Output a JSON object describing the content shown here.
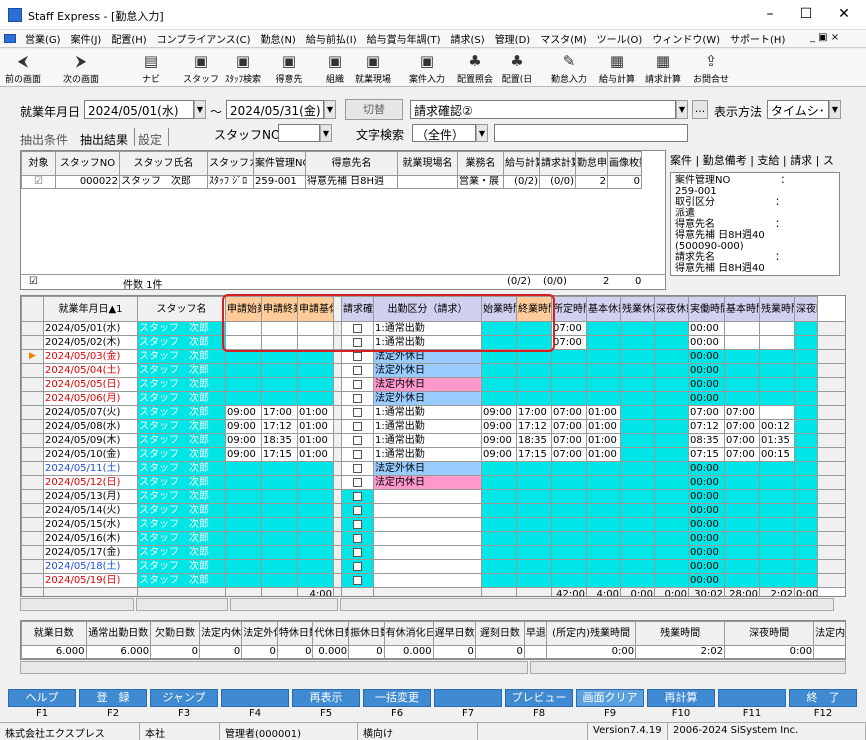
{
  "window": {
    "title": "Staff Express - [勤怠入力]",
    "min": "–",
    "max": "☐",
    "close": "✕"
  },
  "menu": [
    "営業(G)",
    "案件(J)",
    "配置(H)",
    "コンプライアンス(C)",
    "勤怠(N)",
    "給与前払(I)",
    "給与賞与年調(T)",
    "請求(S)",
    "管理(D)",
    "マスタ(M)",
    "ツール(O)",
    "ウィンドウ(W)",
    "サポート(H)"
  ],
  "menu_right": "_ ▣ ×",
  "toolbar": [
    {
      "label": "前の画面",
      "icon": "⮜"
    },
    {
      "label": "次の画面",
      "icon": "⮞"
    },
    {
      "label": "ナビ",
      "icon": "▤"
    },
    {
      "label": "スタッフ",
      "icon": "▣"
    },
    {
      "label": "ｽﾀｯﾌ検索",
      "icon": "▣"
    },
    {
      "label": "得意先",
      "icon": "▣"
    },
    {
      "label": "組織",
      "icon": "▣"
    },
    {
      "label": "就業現場",
      "icon": "▣"
    },
    {
      "label": "案件入力",
      "icon": "▣"
    },
    {
      "label": "配置照会",
      "icon": "♣"
    },
    {
      "label": "配置(日",
      "icon": "♣"
    },
    {
      "label": "勤怠入力",
      "icon": "✎"
    },
    {
      "label": "給与計算",
      "icon": "▦"
    },
    {
      "label": "請求計算",
      "icon": "▦"
    },
    {
      "label": "お問合せ",
      "icon": "⇪"
    }
  ],
  "filter": {
    "label": "就業年月日",
    "from": "2024/05/01(水)",
    "tilde": "～",
    "to": "2024/05/31(金)",
    "switch": "切替",
    "mode": "請求確認②",
    "dots": "...",
    "display_label": "表示方法",
    "display_value": "タイムシ･",
    "tabs": [
      "抽出条件",
      "抽出結果",
      "設定"
    ],
    "staff_label": "スタッフNO",
    "text_search_label": "文字検索",
    "text_search_value": "（全件）"
  },
  "top_table": {
    "headers": [
      "対象",
      "スタッフNO",
      "スタッフ氏名",
      "スタッフカナ",
      "案件管理NO",
      "得意先名",
      "就業現場名",
      "業務名",
      "給与計算",
      "請求計算",
      "勤怠申請",
      "画像枚数"
    ],
    "row": [
      "☑",
      "000022",
      "スタッフ　次郎",
      "ｽﾀｯﾌ ｼﾞﾛ",
      "259-001",
      "得意先補 日8H週",
      "",
      "営業・展",
      "(0/2)",
      "(0/0)",
      "2",
      "0"
    ],
    "footer": {
      "count": "件数 1件",
      "kyuyo": "(0/2)",
      "seikyu": "(0/0)",
      "shinsei": "2",
      "gazou": "0"
    }
  },
  "side_panel": {
    "tabs": [
      "案件",
      "勤怠備考",
      "支給",
      "請求",
      "ス"
    ],
    "lines": [
      "案件管理NO　　　　　：",
      "259-001",
      "取引区分　　　　　　：",
      "派遣",
      "得意先名　　　　　　：",
      "得意先補 日8H週40",
      "(500090-000)",
      "請求先名　　　　　　：",
      "得意先補 日8H週40"
    ]
  },
  "grid": {
    "headers": {
      "date": "就業年月日▲1",
      "staff": "スタッフ名",
      "sin_start": "申請始業",
      "sin_end": "申請終業",
      "sin_break": "申請基休",
      "confirm": "請求確認",
      "kubun": "出勤区分（請求）",
      "start": "始業時間",
      "end": "終業時間",
      "shotei": "所定時間",
      "kihon": "基本休憩",
      "zangyo": "残業休憩",
      "shinya": "深夜休憩",
      "jitsu": "実働時間",
      "kihon2": "基本時間",
      "zangyo2": "残業時間",
      "shinya2": "深夜時間"
    },
    "rows": [
      {
        "date": "2024/05/01(水)",
        "staff": "スタッフ　次郎",
        "ss": "",
        "se": "",
        "sb": "",
        "k": "1:通常出勤",
        "st": "",
        "en": "",
        "sh": "07:00",
        "kh": "",
        "zk": "",
        "sk": "",
        "j": "00:00",
        "k2": "",
        "z2": "",
        "n2": "",
        "dc": "",
        "bg": "w"
      },
      {
        "date": "2024/05/02(木)",
        "staff": "スタッフ　次郎",
        "ss": "",
        "se": "",
        "sb": "",
        "k": "1:通常出勤",
        "st": "",
        "en": "",
        "sh": "07:00",
        "kh": "",
        "zk": "",
        "sk": "",
        "j": "00:00",
        "k2": "",
        "z2": "",
        "n2": "",
        "dc": "",
        "bg": "w"
      },
      {
        "date": "2024/05/03(金)",
        "staff": "スタッフ　次郎",
        "ss": "",
        "se": "",
        "sb": "",
        "k": "法定外休日",
        "st": "",
        "en": "",
        "sh": "",
        "kh": "",
        "zk": "",
        "sk": "",
        "j": "00:00",
        "k2": "",
        "z2": "",
        "n2": "",
        "dc": "red",
        "bg": "b"
      },
      {
        "date": "2024/05/04(土)",
        "staff": "スタッフ　次郎",
        "ss": "",
        "se": "",
        "sb": "",
        "k": "法定外休日",
        "st": "",
        "en": "",
        "sh": "",
        "kh": "",
        "zk": "",
        "sk": "",
        "j": "00:00",
        "k2": "",
        "z2": "",
        "n2": "",
        "dc": "red",
        "bg": "b"
      },
      {
        "date": "2024/05/05(日)",
        "staff": "スタッフ　次郎",
        "ss": "",
        "se": "",
        "sb": "",
        "k": "法定内休日",
        "st": "",
        "en": "",
        "sh": "",
        "kh": "",
        "zk": "",
        "sk": "",
        "j": "00:00",
        "k2": "",
        "z2": "",
        "n2": "",
        "dc": "red",
        "bg": "p"
      },
      {
        "date": "2024/05/06(月)",
        "staff": "スタッフ　次郎",
        "ss": "",
        "se": "",
        "sb": "",
        "k": "法定外休日",
        "st": "",
        "en": "",
        "sh": "",
        "kh": "",
        "zk": "",
        "sk": "",
        "j": "00:00",
        "k2": "",
        "z2": "",
        "n2": "",
        "dc": "red",
        "bg": "b"
      },
      {
        "date": "2024/05/07(火)",
        "staff": "スタッフ　次郎",
        "ss": "09:00",
        "se": "17:00",
        "sb": "01:00",
        "k": "1:通常出勤",
        "st": "09:00",
        "en": "17:00",
        "sh": "07:00",
        "kh": "01:00",
        "zk": "",
        "sk": "",
        "j": "07:00",
        "k2": "07:00",
        "z2": "",
        "n2": "",
        "dc": "",
        "bg": "w"
      },
      {
        "date": "2024/05/08(水)",
        "staff": "スタッフ　次郎",
        "ss": "09:00",
        "se": "17:12",
        "sb": "01:00",
        "k": "1:通常出勤",
        "st": "09:00",
        "en": "17:12",
        "sh": "07:00",
        "kh": "01:00",
        "zk": "",
        "sk": "",
        "j": "07:12",
        "k2": "07:00",
        "z2": "00:12",
        "n2": "",
        "dc": "",
        "bg": "w"
      },
      {
        "date": "2024/05/09(木)",
        "staff": "スタッフ　次郎",
        "ss": "09:00",
        "se": "18:35",
        "sb": "01:00",
        "k": "1:通常出勤",
        "st": "09:00",
        "en": "18:35",
        "sh": "07:00",
        "kh": "01:00",
        "zk": "",
        "sk": "",
        "j": "08:35",
        "k2": "07:00",
        "z2": "01:35",
        "n2": "",
        "dc": "",
        "bg": "w"
      },
      {
        "date": "2024/05/10(金)",
        "staff": "スタッフ　次郎",
        "ss": "09:00",
        "se": "17:15",
        "sb": "01:00",
        "k": "1:通常出勤",
        "st": "09:00",
        "en": "17:15",
        "sh": "07:00",
        "kh": "01:00",
        "zk": "",
        "sk": "",
        "j": "07:15",
        "k2": "07:00",
        "z2": "00:15",
        "n2": "",
        "dc": "",
        "bg": "w"
      },
      {
        "date": "2024/05/11(土)",
        "staff": "スタッフ　次郎",
        "ss": "",
        "se": "",
        "sb": "",
        "k": "法定外休日",
        "st": "",
        "en": "",
        "sh": "",
        "kh": "",
        "zk": "",
        "sk": "",
        "j": "00:00",
        "k2": "",
        "z2": "",
        "n2": "",
        "dc": "blue",
        "bg": "b"
      },
      {
        "date": "2024/05/12(日)",
        "staff": "スタッフ　次郎",
        "ss": "",
        "se": "",
        "sb": "",
        "k": "法定内休日",
        "st": "",
        "en": "",
        "sh": "",
        "kh": "",
        "zk": "",
        "sk": "",
        "j": "00:00",
        "k2": "",
        "z2": "",
        "n2": "",
        "dc": "red",
        "bg": "p"
      },
      {
        "date": "2024/05/13(月)",
        "staff": "スタッフ　次郎",
        "ss": "",
        "se": "",
        "sb": "",
        "k": "",
        "st": "",
        "en": "",
        "sh": "",
        "kh": "",
        "zk": "",
        "sk": "",
        "j": "00:00",
        "k2": "",
        "z2": "",
        "n2": "",
        "dc": "",
        "bg": "c"
      },
      {
        "date": "2024/05/14(火)",
        "staff": "スタッフ　次郎",
        "ss": "",
        "se": "",
        "sb": "",
        "k": "",
        "st": "",
        "en": "",
        "sh": "",
        "kh": "",
        "zk": "",
        "sk": "",
        "j": "00:00",
        "k2": "",
        "z2": "",
        "n2": "",
        "dc": "",
        "bg": "c"
      },
      {
        "date": "2024/05/15(水)",
        "staff": "スタッフ　次郎",
        "ss": "",
        "se": "",
        "sb": "",
        "k": "",
        "st": "",
        "en": "",
        "sh": "",
        "kh": "",
        "zk": "",
        "sk": "",
        "j": "00:00",
        "k2": "",
        "z2": "",
        "n2": "",
        "dc": "",
        "bg": "c"
      },
      {
        "date": "2024/05/16(木)",
        "staff": "スタッフ　次郎",
        "ss": "",
        "se": "",
        "sb": "",
        "k": "",
        "st": "",
        "en": "",
        "sh": "",
        "kh": "",
        "zk": "",
        "sk": "",
        "j": "00:00",
        "k2": "",
        "z2": "",
        "n2": "",
        "dc": "",
        "bg": "c"
      },
      {
        "date": "2024/05/17(金)",
        "staff": "スタッフ　次郎",
        "ss": "",
        "se": "",
        "sb": "",
        "k": "",
        "st": "",
        "en": "",
        "sh": "",
        "kh": "",
        "zk": "",
        "sk": "",
        "j": "00:00",
        "k2": "",
        "z2": "",
        "n2": "",
        "dc": "",
        "bg": "c"
      },
      {
        "date": "2024/05/18(土)",
        "staff": "スタッフ　次郎",
        "ss": "",
        "se": "",
        "sb": "",
        "k": "",
        "st": "",
        "en": "",
        "sh": "",
        "kh": "",
        "zk": "",
        "sk": "",
        "j": "00:00",
        "k2": "",
        "z2": "",
        "n2": "",
        "dc": "blue",
        "bg": "c"
      },
      {
        "date": "2024/05/19(日)",
        "staff": "スタッフ　次郎",
        "ss": "",
        "se": "",
        "sb": "",
        "k": "",
        "st": "",
        "en": "",
        "sh": "",
        "kh": "",
        "zk": "",
        "sk": "",
        "j": "00:00",
        "k2": "",
        "z2": "",
        "n2": "",
        "dc": "red",
        "bg": "c"
      }
    ],
    "totals": {
      "sb": "4:00",
      "sh": "42:00",
      "kh": "4:00",
      "zk": "0:00",
      "sk": "0:00",
      "j": "30:02",
      "k2": "28:00",
      "z2": "2:02",
      "n2": "0:00"
    }
  },
  "summary": {
    "headers": [
      "就業日数",
      "通常出勤日数",
      "欠勤日数",
      "法定内休出日",
      "法定外休",
      "特休日数",
      "代休日数",
      "振休日数",
      "有休消化日数",
      "遅早日数",
      "遅刻日数",
      "早退日",
      "(所定内)残業時間",
      "残業時間",
      "深夜時間",
      "法定内休出時間",
      "法定外休"
    ],
    "values": [
      "6.000",
      "6.000",
      "0",
      "0",
      "0",
      "0",
      "0.000",
      "0",
      "0.000",
      "0",
      "0",
      "",
      "0:00",
      "2:02",
      "0:00",
      "0:00",
      "0:0"
    ]
  },
  "fkeys": [
    {
      "label": "ヘルプ",
      "key": "F1"
    },
    {
      "label": "登　録",
      "key": "F2"
    },
    {
      "label": "ジャンプ",
      "key": "F3"
    },
    {
      "label": "",
      "key": "F4"
    },
    {
      "label": "再表示",
      "key": "F5"
    },
    {
      "label": "一括変更",
      "key": "F6"
    },
    {
      "label": "",
      "key": "F7"
    },
    {
      "label": "プレビュー",
      "key": "F8"
    },
    {
      "label": "画面クリア",
      "key": "F9"
    },
    {
      "label": "再計算",
      "key": "F10"
    },
    {
      "label": "",
      "key": "F11"
    },
    {
      "label": "終　了",
      "key": "F12"
    }
  ],
  "status": [
    "株式会社エクスプレス",
    "本社",
    "管理者(000001)",
    "",
    "横向け",
    "",
    "Version7.4.19",
    "2006-2024 SiSystem Inc."
  ]
}
